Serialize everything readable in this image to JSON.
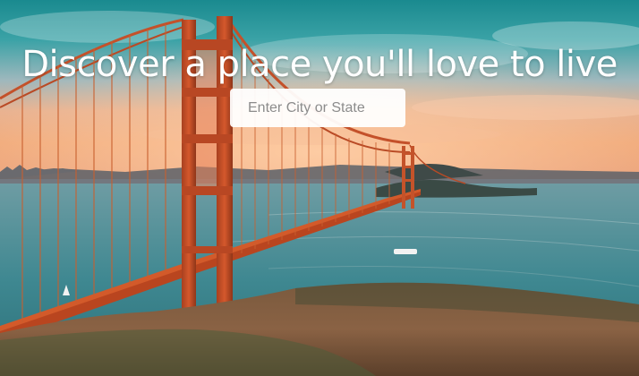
{
  "hero": {
    "title": "Discover a place you'll love to live",
    "background_image": "golden-gate-bridge-photo"
  },
  "search": {
    "placeholder": "Enter City or State",
    "value": ""
  }
}
